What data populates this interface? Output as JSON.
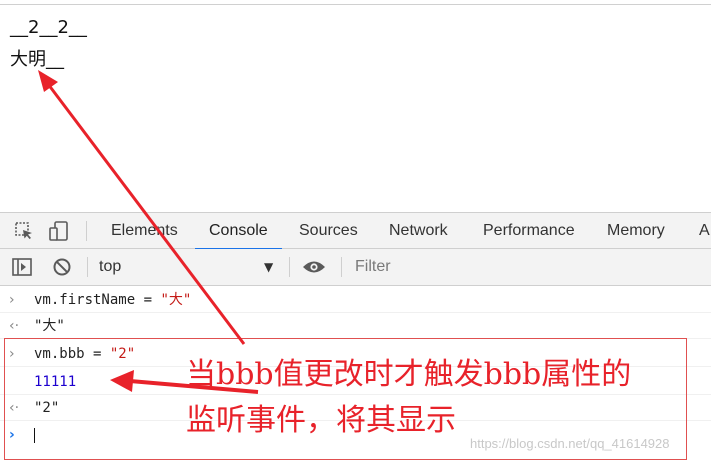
{
  "page": {
    "line1": "__2__2__",
    "line2": "大明__"
  },
  "devtools": {
    "tabs": [
      "Elements",
      "Console",
      "Sources",
      "Network",
      "Performance",
      "Memory",
      "A"
    ],
    "active_tab": "Console",
    "context_selector": "top",
    "filter_placeholder": "Filter",
    "icons": {
      "inspect": "inspect-element-icon",
      "device": "device-toolbar-icon",
      "sidebar": "show-sidebar-icon",
      "clear": "clear-console-icon",
      "eye": "live-expression-icon",
      "dropdown": "dropdown-arrow-icon"
    }
  },
  "console": {
    "entries": [
      {
        "kind": "input",
        "code": "vm.firstName",
        "op": " = ",
        "value": "\"大\""
      },
      {
        "kind": "result",
        "value": "\"大\""
      },
      {
        "kind": "input",
        "code": "vm.bbb",
        "op": " = ",
        "value": "\"2\""
      },
      {
        "kind": "log",
        "value": "11111"
      },
      {
        "kind": "result",
        "value": "\"2\""
      }
    ],
    "prompt_symbol": "›"
  },
  "annotation": {
    "text_line1": "当bbb值更改时才触发bbb属性的",
    "text_line2": "监听事件，将其显示",
    "color": "#e8222a"
  },
  "watermark": "https://blog.csdn.net/qq_41614928",
  "colors": {
    "accent": "#1a73e8",
    "string": "#c41a16",
    "number": "#1c00cf",
    "annotation_red": "#e8222a"
  }
}
